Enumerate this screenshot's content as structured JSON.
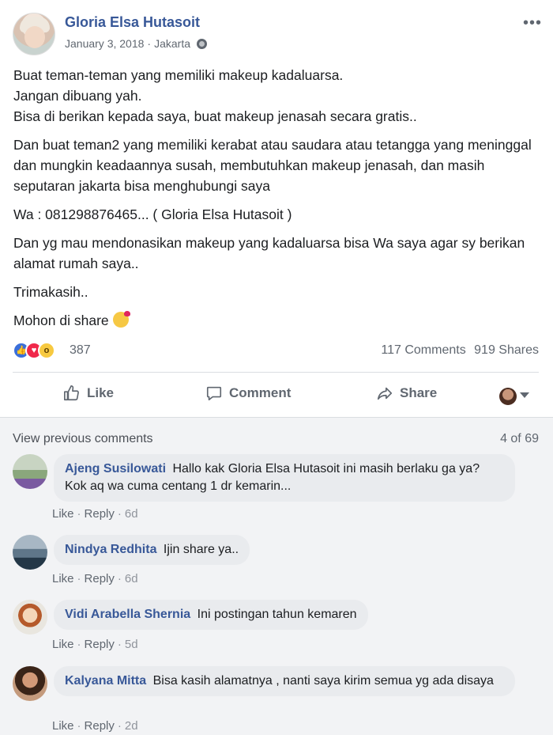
{
  "post": {
    "author": "Gloria Elsa Hutasoit",
    "date": "January 3, 2018",
    "separator": "·",
    "location": "Jakarta",
    "more_label": "•••",
    "paragraphs": [
      "Buat teman-teman yang memiliki makeup kadaluarsa.",
      "Jangan dibuang yah.",
      "Bisa di berikan kepada saya, buat makeup jenasah secara gratis..",
      "Dan buat teman2 yang memiliki kerabat atau saudara atau tetangga yang meninggal dan mungkin keadaannya susah, membutuhkan makeup jenasah, dan masih seputaran jakarta bisa menghubungi saya",
      "Wa : 081298876465... ( Gloria Elsa Hutasoit )",
      "Dan yg mau mendonasikan makeup yang kadaluarsa bisa Wa saya agar sy berikan alamat rumah saya..",
      "Trimakasih..",
      "Mohon di share"
    ],
    "emoji": "kissing-heart-emoji"
  },
  "reactions": {
    "icons": [
      "like-icon",
      "love-icon",
      "wow-icon"
    ],
    "count": "387",
    "comments": "117 Comments",
    "shares": "919 Shares"
  },
  "actions": {
    "like": "Like",
    "comment": "Comment",
    "share": "Share"
  },
  "comments_section": {
    "view_previous": "View previous comments",
    "page_count": "4 of 69",
    "items": [
      {
        "name": "Ajeng Susilowati",
        "text": "Hallo kak Gloria Elsa Hutasoit ini masih berlaku ga ya? Kok aq wa cuma centang 1 dr kemarin...",
        "like": "Like",
        "reply": "Reply",
        "time": "6d"
      },
      {
        "name": "Nindya Redhita",
        "text": "Ijin share ya..",
        "like": "Like",
        "reply": "Reply",
        "time": "6d"
      },
      {
        "name": "Vidi Arabella Shernia",
        "text": "Ini postingan tahun kemaren",
        "like": "Like",
        "reply": "Reply",
        "time": "5d"
      },
      {
        "name": "Kalyana Mitta",
        "text": "Bisa kasih alamatnya , nanti saya kirim semua yg ada disaya",
        "like": "Like",
        "reply": "Reply",
        "time": "2d"
      }
    ]
  },
  "colors": {
    "link_blue": "#385898",
    "secondary_text": "#606770",
    "comment_bubble": "#e9ebee"
  }
}
